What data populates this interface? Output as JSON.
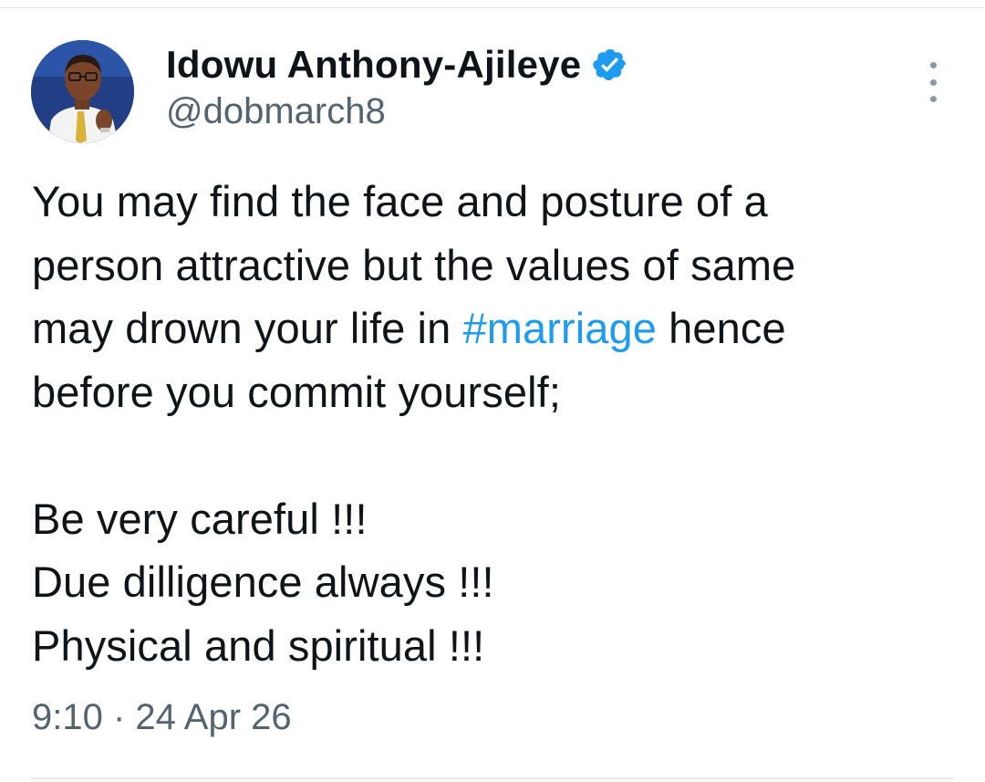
{
  "author": {
    "name": "Idowu Anthony-Ajileye",
    "handle": "@dobmarch8",
    "verified": true,
    "avatar": "profile-photo"
  },
  "tweet": {
    "line1": "You may find the face and posture of a",
    "line2": "person attractive but the values of same",
    "line3_before": "may drown your life in ",
    "hashtag": "#marriage",
    "line3_after": " hence",
    "line4": "before you commit yourself;",
    "line5": "Be very careful !!!",
    "line6": "Due dilligence always !!!",
    "line7": "Physical and spiritual !!!"
  },
  "timestamp": {
    "time": "9:10",
    "separator": " · ",
    "date": "24 Apr 26"
  },
  "colors": {
    "text": "#0f1419",
    "secondary": "#536471",
    "link": "#1d9bf0",
    "verified_badge": "#1d9bf0"
  },
  "icons": {
    "verified": "verified-badge-icon",
    "more": "more-options-icon"
  }
}
